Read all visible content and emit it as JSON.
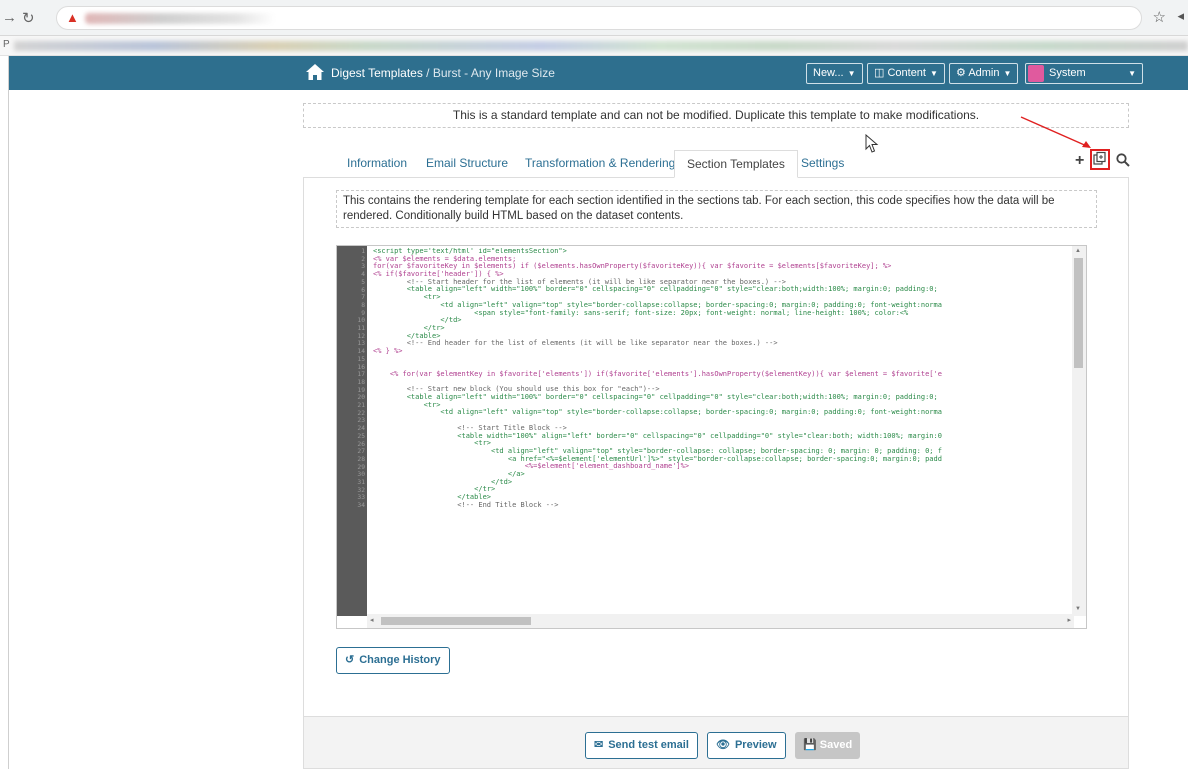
{
  "browser": {
    "back_icon": "→",
    "reload_icon": "↻",
    "star_icon": "☆",
    "bookmark_bar_label": "P"
  },
  "topbar": {
    "breadcrumb_main": "Digest Templates",
    "breadcrumb_sep": " / ",
    "breadcrumb_current": "Burst - Any Image Size",
    "new_label": "New...",
    "content_label": "Content",
    "admin_label": "Admin",
    "user_label": "System",
    "bar_color": "#2e6f8e"
  },
  "notice": "This is a standard template and can not be modified. Duplicate this template to make modifications.",
  "tabs": [
    {
      "label": "Information"
    },
    {
      "label": "Email Structure"
    },
    {
      "label": "Transformation & Rendering"
    },
    {
      "label": "Section Templates"
    },
    {
      "label": "Settings"
    }
  ],
  "active_tab": "Section Templates",
  "tools": {
    "plus_label": "+"
  },
  "description": "This contains the rendering template for each section identified in the sections tab. For each section, this code specifies how the data will be rendered. Conditionally build HTML based on the dataset contents.",
  "code_lines": [
    "<script type='text/html' id=\"elementsSection\">",
    "<% var $elements = $data.elements;",
    "for(var $favoriteKey in $elements) if ($elements.hasOwnProperty($favoriteKey)){ var $favorite = $elements[$favoriteKey]; %>",
    "<% if($favorite['header']) { %>",
    "        <!-- Start header for the list of elements (it will be like separator near the boxes.) -->",
    "        <table align=\"left\" width=\"100%\" border=\"0\" cellspacing=\"0\" cellpadding=\"0\" style=\"clear:both;width:100%; margin:0; padding:0;",
    "            <tr>",
    "                <td align=\"left\" valign=\"top\" style=\"border-collapse:collapse; border-spacing:0; margin:0; padding:0; font-weight:norma",
    "                        <span style=\"font-family: sans-serif; font-size: 20px; font-weight: normal; line-height: 100%; color:<%",
    "                </td>",
    "            </tr>",
    "        </table>",
    "        <!-- End header for the list of elements (it will be like separator near the boxes.) -->",
    "<% } %>",
    "",
    "",
    "    <% for(var $elementKey in $favorite['elements']) if($favorite['elements'].hasOwnProperty($elementKey)){ var $element = $favorite['e",
    "",
    "        <!-- Start new block (You should use this box for \"each\")-->",
    "        <table align=\"left\" width=\"100%\" border=\"0\" cellspacing=\"0\" cellpadding=\"0\" style=\"clear:both;width:100%; margin:0; padding:0;",
    "            <tr>",
    "                <td align=\"left\" valign=\"top\" style=\"border-collapse:collapse; border-spacing:0; margin:0; padding:0; font-weight:norma",
    "",
    "                    <!-- Start Title Block -->",
    "                    <table width=\"100%\" align=\"left\" border=\"0\" cellspacing=\"0\" cellpadding=\"0\" style=\"clear:both; width:100%; margin:0",
    "                        <tr>",
    "                            <td align=\"left\" valign=\"top\" style=\"border-collapse: collapse; border-spacing: 0; margin: 0; padding: 0; f",
    "                                <a href=\"<%=$element['elementUrl']%>\" style=\"border-collapse:collapse; border-spacing:0; margin:0; padd",
    "                                    <%=$element['element_dashboard_name']%>",
    "                                </a>",
    "                            </td>",
    "                        </tr>",
    "                    </table>",
    "                    <!-- End Title Block -->"
  ],
  "change_history_label": "Change History",
  "footer": {
    "send_test_label": "Send test email",
    "preview_label": "Preview",
    "saved_label": "Saved"
  },
  "colors": {
    "accent": "#2c6f93",
    "annotation_red": "#e02020"
  }
}
